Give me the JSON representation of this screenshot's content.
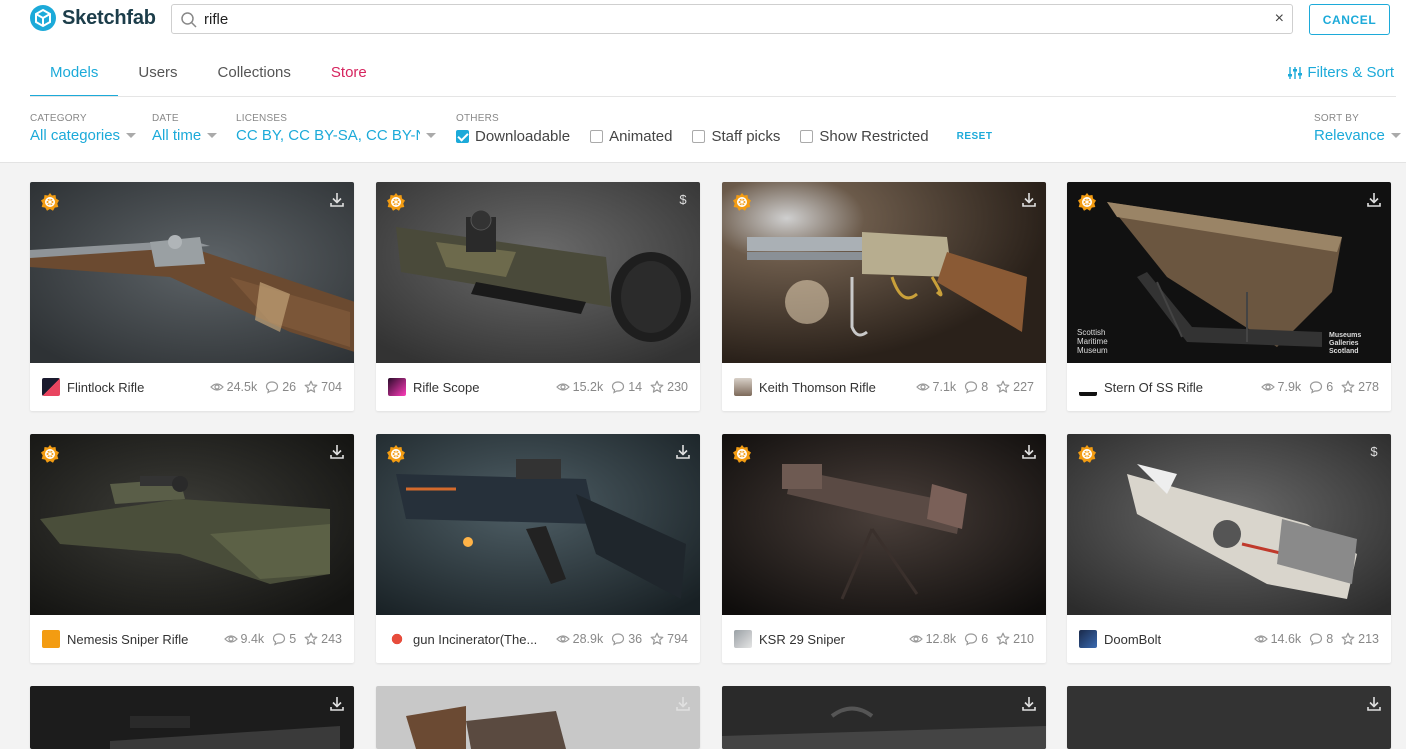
{
  "brand": {
    "name": "Sketchfab"
  },
  "search": {
    "value": "rifle",
    "clear": "×"
  },
  "cancel_label": "CANCEL",
  "tabs": [
    {
      "label": "Models"
    },
    {
      "label": "Users"
    },
    {
      "label": "Collections"
    },
    {
      "label": "Store"
    }
  ],
  "filters_sort_label": "Filters & Sort",
  "filters": {
    "category": {
      "label": "CATEGORY",
      "value": "All categories"
    },
    "date": {
      "label": "DATE",
      "value": "All time"
    },
    "licenses": {
      "label": "LICENSES",
      "value": "CC BY, CC BY-SA, CC BY-ND, C"
    },
    "others": {
      "label": "OTHERS"
    },
    "checks": [
      {
        "label": "Downloadable",
        "checked": true
      },
      {
        "label": "Animated",
        "checked": false
      },
      {
        "label": "Staff picks",
        "checked": false
      },
      {
        "label": "Show Restricted",
        "checked": false
      }
    ],
    "reset": "RESET",
    "sort": {
      "label": "SORT BY",
      "value": "Relevance"
    }
  },
  "models": [
    {
      "title": "Flintlock Rifle",
      "views": "24.5k",
      "comments": "26",
      "likes": "704",
      "corner": "download"
    },
    {
      "title": "Rifle Scope",
      "views": "15.2k",
      "comments": "14",
      "likes": "230",
      "corner": "$"
    },
    {
      "title": "Keith Thomson Rifle",
      "views": "7.1k",
      "comments": "8",
      "likes": "227",
      "corner": "download"
    },
    {
      "title": "Stern Of SS Rifle",
      "views": "7.9k",
      "comments": "6",
      "likes": "278",
      "corner": "download"
    },
    {
      "title": "Nemesis Sniper Rifle",
      "views": "9.4k",
      "comments": "5",
      "likes": "243",
      "corner": "download"
    },
    {
      "title": "gun Incinerator(The...",
      "views": "28.9k",
      "comments": "36",
      "likes": "794",
      "corner": "download"
    },
    {
      "title": "KSR 29 Sniper",
      "views": "12.8k",
      "comments": "6",
      "likes": "210",
      "corner": "download"
    },
    {
      "title": "DoomBolt",
      "views": "14.6k",
      "comments": "8",
      "likes": "213",
      "corner": "$"
    }
  ],
  "thumbnail_text": {
    "stern_logo_left": "Scottish Maritime Museum",
    "stern_logo_right": "Museums Galleries Scotland"
  },
  "colors": {
    "accent": "#1caad9",
    "store": "#d6245e",
    "badge": "#f39c12"
  }
}
